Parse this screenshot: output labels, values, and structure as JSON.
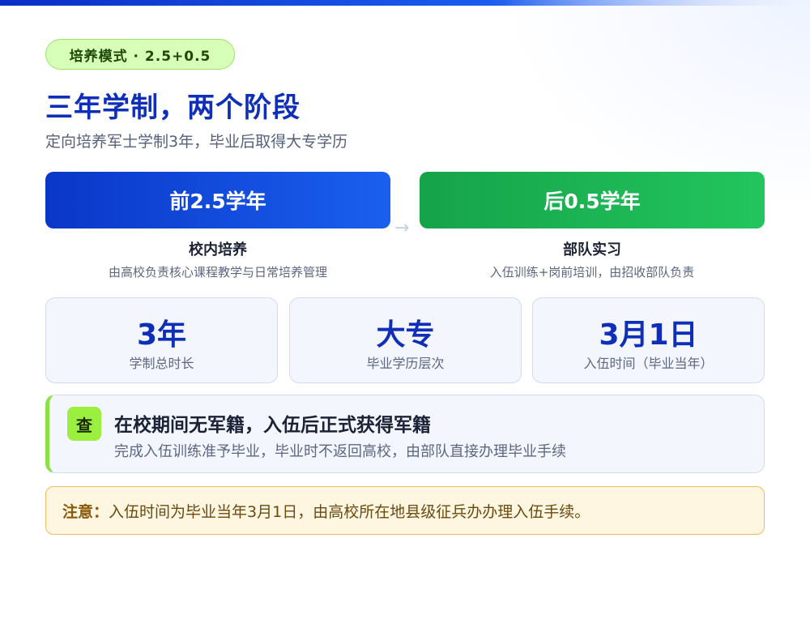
{
  "badge": "培养模式 · 2.5+0.5",
  "title": "三年学制，两个阶段",
  "subtitle": "定向培养军士学制3年，毕业后取得大专学历",
  "phases": [
    {
      "label": "前2.5学年",
      "heading": "校内培养",
      "description": "由高校负责核心课程教学与日常培养管理"
    },
    {
      "label": "后0.5学年",
      "heading": "部队实习",
      "description": "入伍训练+岗前培训，由招收部队负责"
    }
  ],
  "arrow": "→",
  "stats": [
    {
      "value": "3年",
      "label": "学制总时长"
    },
    {
      "value": "大专",
      "label": "毕业学历层次"
    },
    {
      "value": "3月1日",
      "label": "入伍时间（毕业当年）"
    }
  ],
  "callout": {
    "icon_text": "查",
    "title": "在校期间无军籍，入伍后正式获得军籍",
    "description": "完成入伍训练准予毕业，毕业时不返回高校，由部队直接办理毕业手续"
  },
  "note": {
    "label": "注意：",
    "text": "入伍时间为毕业当年3月1日，由高校所在地县级征兵办办理入伍手续。"
  },
  "colors": {
    "primary_blue": "#0f2fb8",
    "phase1_gradient": [
      "#0a37c8",
      "#1a5fee"
    ],
    "phase2_gradient": [
      "#16a34a",
      "#22c55e"
    ],
    "accent_green": "#9bef3f",
    "note_bg": "#fef6e0"
  }
}
